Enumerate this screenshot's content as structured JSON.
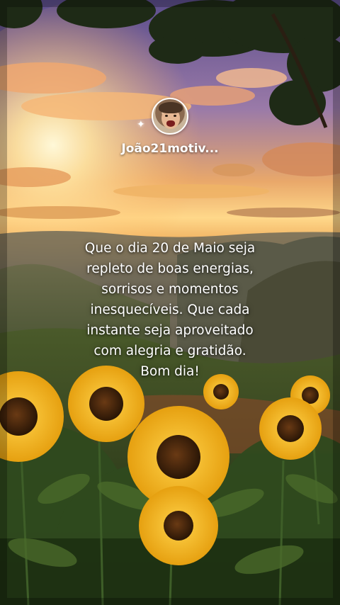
{
  "profile": {
    "username": "João21motiv...",
    "avatar_label": "avatar",
    "sparkle_icon": "sparkle-icon"
  },
  "message": {
    "lines": [
      "Que o dia 20 de Maio seja",
      "repleto de boas energias,",
      "sorrisos e momentos",
      "inesquecíveis. Que cada",
      "instante seja aproveitado",
      "com alegria e gratidão.",
      "Bom dia!"
    ]
  },
  "colors": {
    "sky_top": "#6a5a9a",
    "sky_glow": "#ffd27a",
    "sunflower_petal": "#f5c518",
    "sunflower_center": "#4a2a10",
    "foliage": "#2f4a1e"
  }
}
